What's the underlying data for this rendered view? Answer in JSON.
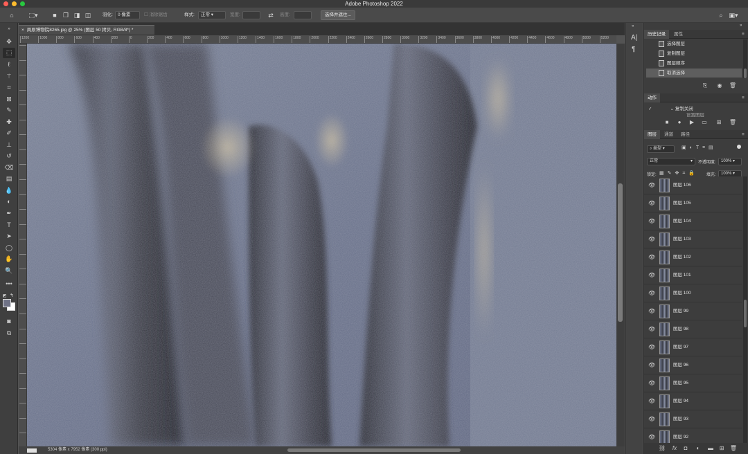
{
  "app": {
    "title": "Adobe Photoshop 2022"
  },
  "options_bar": {
    "feather_label": "羽化:",
    "feather_value": "0 像素",
    "anti_alias_label": "消除锯齿",
    "style_label": "样式:",
    "style_value": "正常",
    "width_label": "宽度:",
    "height_label": "高度:",
    "select_mask_button": "选择并遮住..."
  },
  "document": {
    "tab_title": "周原博物院8265.jpg @ 25% (图层 50 拷贝, RGB/8*) *",
    "status": "5304 像素 x 7952 像素 (300 ppi)",
    "ruler_h": [
      "1200",
      "1000",
      "800",
      "600",
      "400",
      "200",
      "0",
      "200",
      "400",
      "600",
      "800",
      "1000",
      "1200",
      "1400",
      "1600",
      "1800",
      "2000",
      "2200",
      "2400",
      "2600",
      "2800",
      "3000",
      "3200",
      "3400",
      "3600",
      "3800",
      "4000",
      "4200",
      "4400",
      "4600",
      "4800",
      "5000",
      "5200"
    ],
    "ruler_v": [
      "1",
      "2",
      "3",
      "4",
      "5",
      "6",
      "7",
      "8",
      "9",
      "10",
      "11",
      "12",
      "13",
      "14",
      "15",
      "16",
      "17",
      "18",
      "19",
      "20",
      "21",
      "22",
      "23",
      "24",
      "25",
      "26",
      "27"
    ]
  },
  "history_panel": {
    "tabs": [
      "历史记录",
      "属性"
    ],
    "items": [
      "选择图层",
      "复制图层",
      "图层顺序",
      "取消选择"
    ],
    "selected_index": 3
  },
  "actions_panel": {
    "tab": "动作",
    "items": [
      "复制关闭",
      "设置图层"
    ]
  },
  "layers_panel": {
    "tabs": [
      "图层",
      "通道",
      "路径"
    ],
    "filter_kind": "类型",
    "blend_mode": "正常",
    "opacity_label": "不透明度:",
    "opacity_value": "100%",
    "lock_label": "锁定:",
    "fill_label": "填充:",
    "fill_value": "100%",
    "layers": [
      "图层 106",
      "图层 105",
      "图层 104",
      "图层 103",
      "图层 102",
      "图层 101",
      "图层 100",
      "图层 99",
      "图层 98",
      "图层 97",
      "图层 96",
      "图层 95",
      "图层 94",
      "图层 93",
      "图层 92"
    ]
  },
  "colors": {
    "foreground": "#6f7286",
    "background": "#ffffff"
  }
}
